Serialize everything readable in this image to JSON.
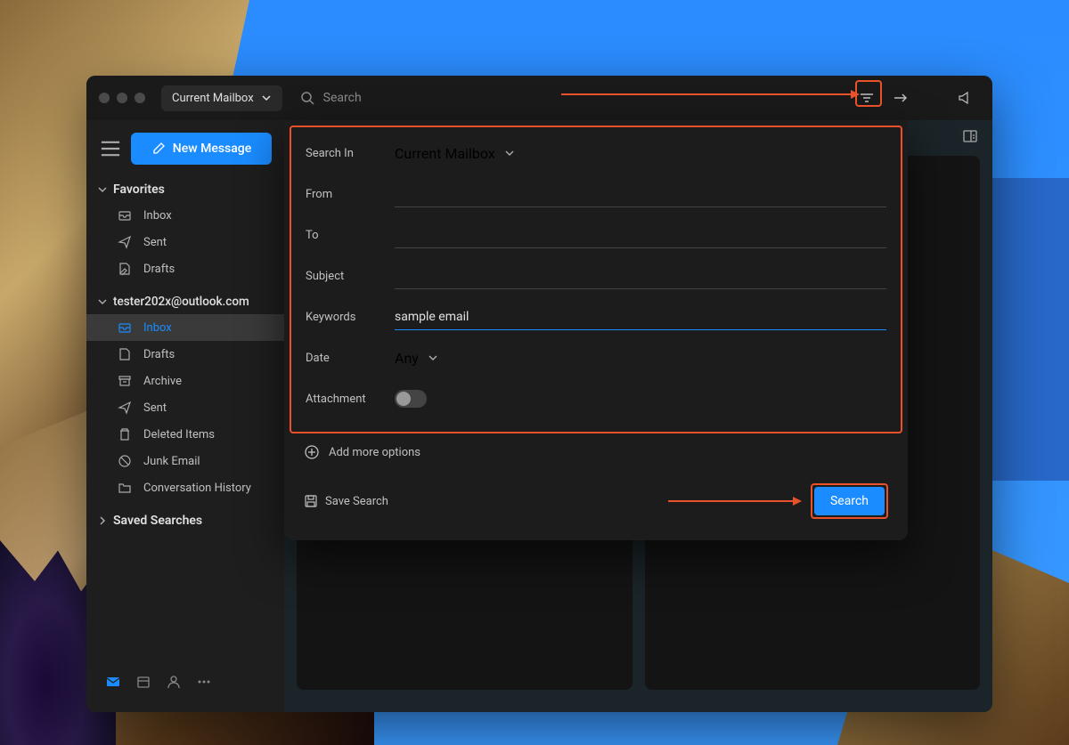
{
  "titlebar": {
    "scope_label": "Current Mailbox",
    "search_placeholder": "Search"
  },
  "sidebar": {
    "new_message_label": "New Message",
    "favorites_label": "Favorites",
    "favorites_items": [
      {
        "icon": "inbox",
        "label": "Inbox"
      },
      {
        "icon": "send",
        "label": "Sent"
      },
      {
        "icon": "drafts",
        "label": "Drafts"
      }
    ],
    "account_label": "tester202x@outlook.com",
    "account_items": [
      {
        "icon": "inbox",
        "label": "Inbox",
        "selected": true
      },
      {
        "icon": "drafts",
        "label": "Drafts"
      },
      {
        "icon": "archive",
        "label": "Archive"
      },
      {
        "icon": "send",
        "label": "Sent"
      },
      {
        "icon": "trash",
        "label": "Deleted Items"
      },
      {
        "icon": "junk",
        "label": "Junk Email"
      },
      {
        "icon": "folder",
        "label": "Conversation History"
      }
    ],
    "saved_searches_label": "Saved Searches"
  },
  "search_panel": {
    "search_in_label": "Search In",
    "search_in_value": "Current Mailbox",
    "from_label": "From",
    "from_value": "",
    "to_label": "To",
    "to_value": "",
    "subject_label": "Subject",
    "subject_value": "",
    "keywords_label": "Keywords",
    "keywords_value": "sample email",
    "date_label": "Date",
    "date_value": "Any",
    "attachment_label": "Attachment",
    "attachment_on": false,
    "add_more_label": "Add more options",
    "save_search_label": "Save Search",
    "search_button_label": "Search"
  },
  "colors": {
    "accent": "#1a8cff",
    "annotation": "#e8512a"
  }
}
